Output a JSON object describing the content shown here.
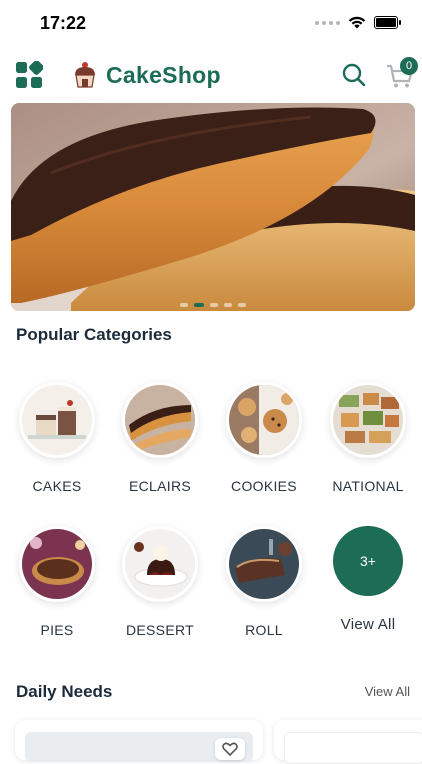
{
  "status_bar": {
    "time": "17:22"
  },
  "header": {
    "brand": "CakeShop",
    "cart_count": "0"
  },
  "banner": {
    "dot_count": 5,
    "active_dot": 2
  },
  "popular": {
    "title": "Popular Categories",
    "categories": [
      {
        "label": "CAKES",
        "icon": "cakes-thumbnail"
      },
      {
        "label": "ECLAIRS",
        "icon": "eclairs-thumbnail"
      },
      {
        "label": "COOKIES",
        "icon": "cookies-thumbnail"
      },
      {
        "label": "NATIONAL",
        "icon": "national-thumbnail"
      },
      {
        "label": "PIES",
        "icon": "pies-thumbnail"
      },
      {
        "label": "DESSERT",
        "icon": "dessert-thumbnail"
      },
      {
        "label": "ROLL",
        "icon": "roll-thumbnail"
      }
    ],
    "more_count": "3+",
    "view_all_label": "View All"
  },
  "daily_needs": {
    "title": "Daily Needs",
    "view_all_label": "View All"
  },
  "colors": {
    "brand_green": "#1d6c56",
    "heading_text": "#1c2b3a"
  }
}
